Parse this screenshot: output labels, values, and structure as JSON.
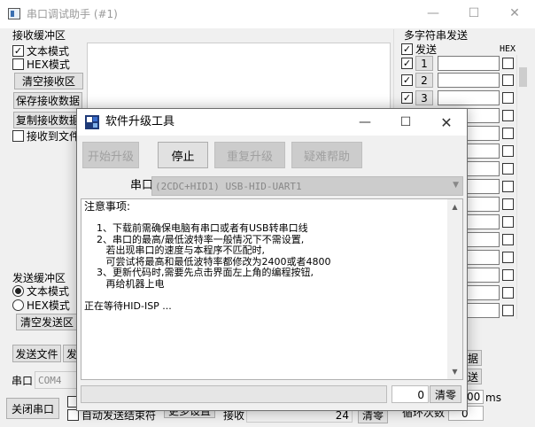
{
  "main_window": {
    "title": "串口调试助手 (#1)",
    "receive_group_label": "接收缓冲区",
    "text_mode_label": "文本模式",
    "hex_mode_label": "HEX模式",
    "clear_receive_label": "清空接收区",
    "save_receive_label": "保存接收数据",
    "copy_receive_label": "复制接收数据",
    "receive_to_file_label": "接收到文件",
    "send_group_label": "发送缓冲区",
    "send_text_mode_label": "文本模式",
    "send_hex_mode_label": "HEX模式",
    "clear_send_label": "清空发送区",
    "send_file_label": "发送文件",
    "send_partial_label": "发",
    "port_label": "串口",
    "port_value": "COM4",
    "close_port_label": "关闭串口",
    "auto_send_end_label": "自动发送结束符",
    "more_settings_label": "更多设置",
    "receive_count_label": "接收",
    "receive_count_value": "24",
    "clear_count_label": "清零",
    "loop_count_label": "循环次数",
    "loop_count_value": "0",
    "ms_label": "ms",
    "ms_value": "00",
    "multi_send_group_label": "多字符串发送",
    "multi_send_header": "发送",
    "multi_hex_header": "HEX",
    "multi_rows": [
      "1",
      "2",
      "3"
    ],
    "right_partial_1": "据",
    "right_partial_2": "送"
  },
  "dialog": {
    "title": "软件升级工具",
    "start_upgrade_label": "开始升级",
    "stop_label": "停止",
    "re_upgrade_label": "重复升级",
    "help_label": "疑难帮助",
    "port_label": "串口",
    "port_value": "(2CDC+HID1) USB-HID-UART1",
    "notes": [
      "注意事项:",
      "",
      "    1、下载前需确保电脑有串口或者有USB转串口线",
      "    2、串口的最高/最低波特率一般情况下不需设置,",
      "       若出现串口的速度与本程序不匹配时,",
      "       可尝试将最高和最低波特率都修改为2400或者4800",
      "    3、更新代码时,需要先点击界面左上角的编程按钮,",
      "       再给机器上电",
      "",
      "正在等待HID-ISP ..."
    ],
    "progress_value": "0",
    "clear_label": "清零"
  }
}
